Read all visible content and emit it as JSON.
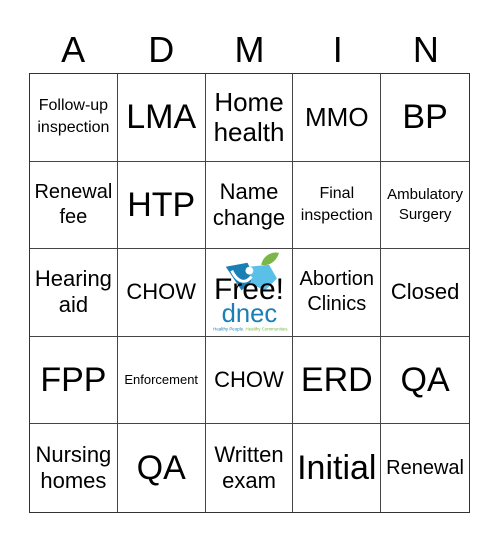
{
  "header": {
    "letters": [
      "A",
      "D",
      "M",
      "I",
      "N"
    ]
  },
  "board": {
    "cells": [
      {
        "text": "Follow-up inspection",
        "size": "s-s"
      },
      {
        "text": "LMA",
        "size": "s-xl"
      },
      {
        "text": "Home health",
        "size": "s-l"
      },
      {
        "text": "MMO",
        "size": "s-l"
      },
      {
        "text": "BP",
        "size": "s-xl"
      },
      {
        "text": "Renewal fee",
        "size": "s-n"
      },
      {
        "text": "HTP",
        "size": "s-xl"
      },
      {
        "text": "Name change",
        "size": "s-m"
      },
      {
        "text": "Final inspection",
        "size": "s-s"
      },
      {
        "text": "Ambulatory Surgery",
        "size": "s-xs"
      },
      {
        "text": "Hearing aid",
        "size": "s-m"
      },
      {
        "text": "CHOW",
        "size": "s-m"
      },
      {
        "text": "Free!",
        "size": "free"
      },
      {
        "text": "Abortion Clinics",
        "size": "s-n"
      },
      {
        "text": "Closed",
        "size": "s-m"
      },
      {
        "text": "FPP",
        "size": "s-xl"
      },
      {
        "text": "Enforcement",
        "size": "s-xxs"
      },
      {
        "text": "CHOW",
        "size": "s-m"
      },
      {
        "text": "ERD",
        "size": "s-xl"
      },
      {
        "text": "QA",
        "size": "s-xl"
      },
      {
        "text": "Nursing homes",
        "size": "s-m"
      },
      {
        "text": "QA",
        "size": "s-xl"
      },
      {
        "text": "Written exam",
        "size": "s-m"
      },
      {
        "text": "Initial",
        "size": "s-xl"
      },
      {
        "text": "Renewal",
        "size": "s-n"
      }
    ]
  },
  "free_space": {
    "label": "Free!",
    "logo_text": "dnec",
    "tagline_a": "Healthy People.",
    "tagline_b": "Healthy Communities.",
    "colors": {
      "blue": "#1a7fb5",
      "light_blue": "#5bc0e8",
      "green": "#7ab648",
      "dark_blue": "#1b5e8c"
    }
  }
}
